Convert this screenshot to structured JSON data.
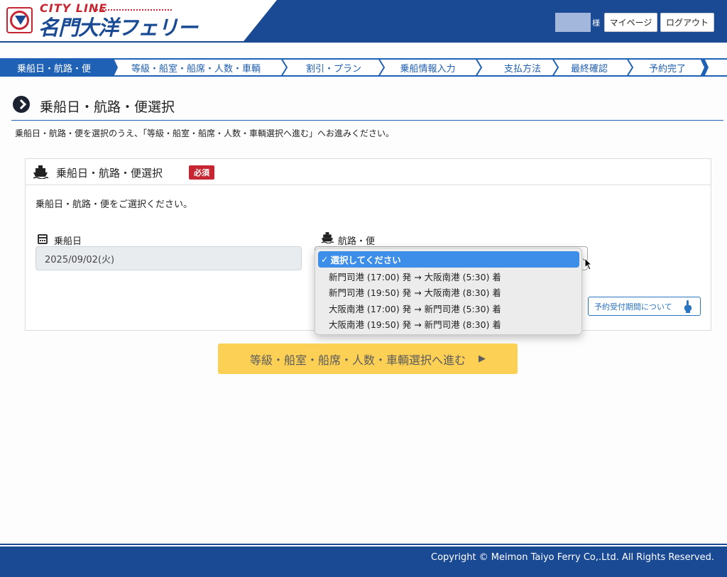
{
  "brand": {
    "city_line": "CITY LINE",
    "name": "名門大洋フェリー"
  },
  "header": {
    "user_suffix": "様",
    "mypage_label": "マイページ",
    "logout_label": "ログアウト"
  },
  "steps": [
    {
      "label": "乗船日・航路・便",
      "active": true
    },
    {
      "label": "等級・船室・船席・人数・車輌",
      "active": false
    },
    {
      "label": "割引・プラン",
      "active": false
    },
    {
      "label": "乗船情報入力",
      "active": false
    },
    {
      "label": "支払方法",
      "active": false
    },
    {
      "label": "最終確認",
      "active": false
    },
    {
      "label": "予約完了",
      "active": false
    }
  ],
  "page": {
    "title": "乗船日・航路・便選択",
    "intro": "乗船日・航路・便を選択のうえ、「等級・船室・船席・人数・車輌選択へ進む」へお進みください。"
  },
  "card": {
    "title": "乗船日・航路・便選択",
    "required_badge": "必須",
    "description": "乗船日・航路・便をご選択ください。",
    "date_label": "乗船日",
    "date_value": "2025/09/02(火)",
    "route_label": "航路・便",
    "period_button": "予約受付期間について"
  },
  "dropdown": {
    "selected_index": 0,
    "options": [
      "選択してください",
      "新門司港 (17:00) 発 → 大阪南港 (5:30) 着",
      "新門司港 (19:50) 発 → 大阪南港 (8:30) 着",
      "大阪南港 (17:00) 発 → 新門司港 (5:30) 着",
      "大阪南港 (19:50) 発 → 新門司港 (8:30) 着"
    ]
  },
  "proceed": {
    "label": "等級・船室・船席・人数・車輌選択へ進む",
    "arrow": "▶"
  },
  "footer": {
    "copyright": "Copyright © Meimon Taiyo Ferry Co,.Ltd. All Rights Reserved."
  },
  "colors": {
    "brand_blue": "#1a4a94",
    "step_blue": "#1f62b5",
    "required_red": "#c62632",
    "proceed_yellow": "#fbd055",
    "selected_option": "#3d8ee8"
  }
}
